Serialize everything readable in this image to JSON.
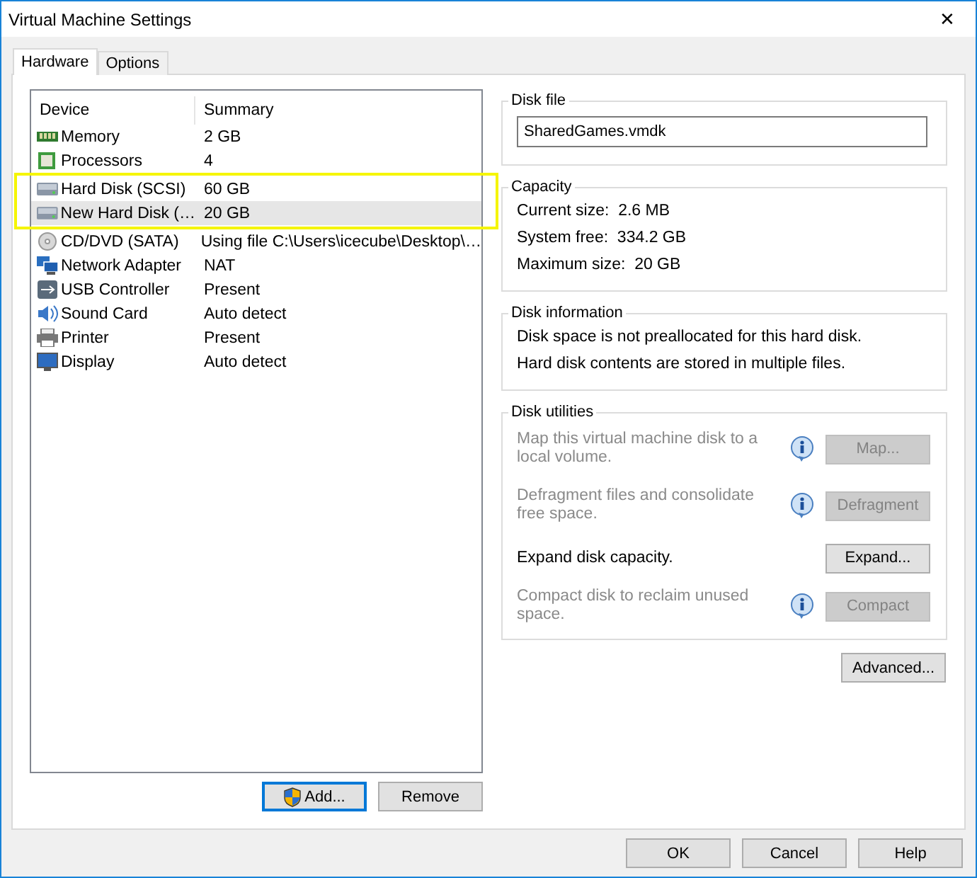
{
  "window": {
    "title": "Virtual Machine Settings",
    "close": "✕"
  },
  "tabs": [
    {
      "label": "Hardware",
      "selected": true
    },
    {
      "label": "Options",
      "selected": false
    }
  ],
  "devices": {
    "columns": [
      "Device",
      "Summary"
    ],
    "rows": [
      {
        "kind": "memory",
        "device": "Memory",
        "summary": "2 GB",
        "selected": false,
        "highlighted": false
      },
      {
        "kind": "processor",
        "device": "Processors",
        "summary": "4",
        "selected": false,
        "highlighted": false
      },
      {
        "kind": "disk",
        "device": "Hard Disk (SCSI)",
        "summary": "60 GB",
        "selected": false,
        "highlighted": true
      },
      {
        "kind": "disk",
        "device": "New Hard Disk (…",
        "summary": "20 GB",
        "selected": true,
        "highlighted": true
      },
      {
        "kind": "cd",
        "device": "CD/DVD (SATA)",
        "summary": "Using file C:\\Users\\icecube\\Desktop\\…",
        "selected": false,
        "highlighted": false
      },
      {
        "kind": "network",
        "device": "Network Adapter",
        "summary": "NAT",
        "selected": false,
        "highlighted": false
      },
      {
        "kind": "usb",
        "device": "USB Controller",
        "summary": "Present",
        "selected": false,
        "highlighted": false
      },
      {
        "kind": "sound",
        "device": "Sound Card",
        "summary": "Auto detect",
        "selected": false,
        "highlighted": false
      },
      {
        "kind": "printer",
        "device": "Printer",
        "summary": "Present",
        "selected": false,
        "highlighted": false
      },
      {
        "kind": "display",
        "device": "Display",
        "summary": "Auto detect",
        "selected": false,
        "highlighted": false
      }
    ],
    "buttons": [
      {
        "label": "Add...",
        "shield": true,
        "focused": true
      },
      {
        "label": "Remove",
        "shield": false,
        "focused": false
      }
    ]
  },
  "disk_file": {
    "title": "Disk file",
    "value": "SharedGames.vmdk"
  },
  "capacity": {
    "title": "Capacity",
    "lines": [
      "Current size:  2.6 MB",
      "System free:  334.2 GB",
      "Maximum size:  20 GB"
    ]
  },
  "disk_information": {
    "title": "Disk information",
    "lines": [
      "Disk space is not preallocated for this hard disk.",
      "Hard disk contents are stored in multiple files."
    ]
  },
  "disk_utilities": {
    "title": "Disk utilities",
    "items": [
      {
        "text": "Map this virtual machine disk to a local volume.",
        "button": "Map...",
        "disabled": true,
        "info": true
      },
      {
        "text": "Defragment files and consolidate free space.",
        "button": "Defragment",
        "disabled": true,
        "info": true
      },
      {
        "text": "Expand disk capacity.",
        "button": "Expand...",
        "disabled": false,
        "info": false
      },
      {
        "text": "Compact disk to reclaim unused space.",
        "button": "Compact",
        "disabled": true,
        "info": true
      }
    ]
  },
  "advanced_button": "Advanced...",
  "dialog_buttons": [
    "OK",
    "Cancel",
    "Help"
  ]
}
